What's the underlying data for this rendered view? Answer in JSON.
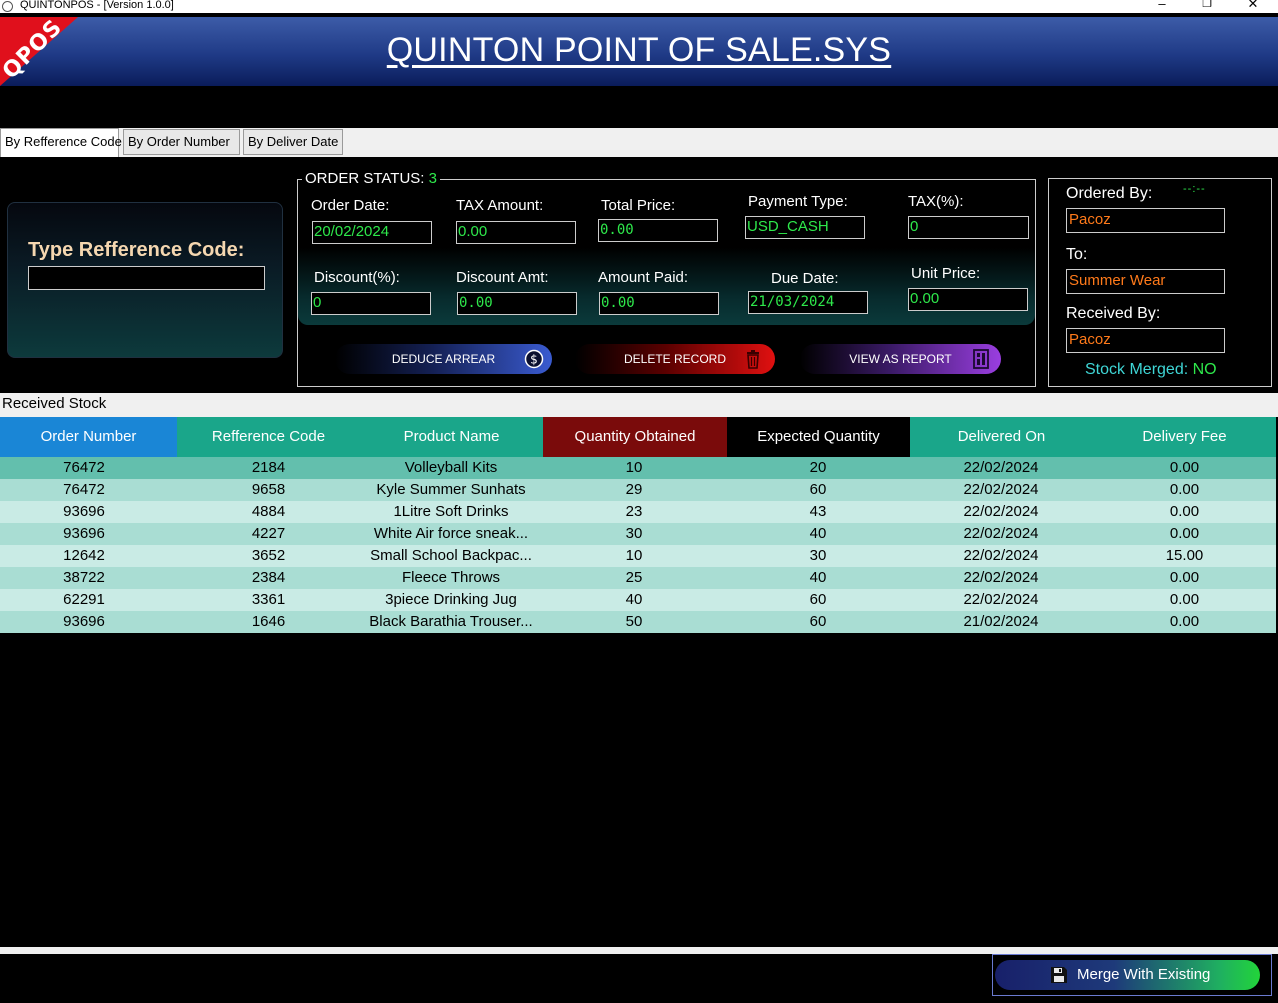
{
  "window": {
    "title": "QUINTONPOS - [Version 1.0.0]",
    "minimize": "–",
    "maximize": "❐",
    "close": "✕"
  },
  "header": {
    "title": "QUINTON POINT OF SALE.SYS",
    "logo_text": "QPOS"
  },
  "tabs": [
    {
      "label": "By Refference Code"
    },
    {
      "label": "By Order Number"
    },
    {
      "label": "By Deliver Date"
    }
  ],
  "search": {
    "label": "Type Refference Code:",
    "value": ""
  },
  "order_status": {
    "label": "ORDER STATUS:",
    "value": "3",
    "fields": {
      "order_date": {
        "label": "Order Date:",
        "value": "20/02/2024"
      },
      "tax_amount": {
        "label": "TAX Amount:",
        "value": "0.00"
      },
      "total_price": {
        "label": "Total Price:",
        "value": "0.00"
      },
      "payment_type": {
        "label": "Payment Type:",
        "value": "USD_CASH"
      },
      "tax_percent": {
        "label": "TAX(%):",
        "value": "0"
      },
      "discount_percent": {
        "label": "Discount(%):",
        "value": "0"
      },
      "discount_amt": {
        "label": "Discount Amt:",
        "value": "0.00"
      },
      "amount_paid": {
        "label": "Amount Paid:",
        "value": "0.00"
      },
      "due_date": {
        "label": "Due Date:",
        "value": "21/03/2024"
      },
      "unit_price": {
        "label": "Unit Price:",
        "value": "0.00"
      }
    }
  },
  "actions": {
    "deduce": "DEDUCE ARREAR",
    "delete": "DELETE RECORD",
    "report": "VIEW AS REPORT"
  },
  "receiver": {
    "ordered_by_label": "Ordered By:",
    "clock": "--:--",
    "ordered_by": "Pacoz",
    "to_label": "To:",
    "to": "Summer Wear",
    "received_by_label": "Received By:",
    "received_by": "Pacoz",
    "stock_merged_label": "Stock Merged:",
    "stock_merged": "NO"
  },
  "table": {
    "caption": "Received Stock",
    "columns": [
      "Order Number",
      "Refference Code",
      "Product Name",
      "Quantity Obtained",
      "Expected Quantity",
      "Delivered On",
      "Delivery Fee"
    ],
    "rows": [
      [
        "76472",
        "2184",
        "Volleyball Kits",
        "10",
        "20",
        "22/02/2024",
        "0.00"
      ],
      [
        "76472",
        "9658",
        "Kyle Summer Sunhats",
        "29",
        "60",
        "22/02/2024",
        "0.00"
      ],
      [
        "93696",
        "4884",
        "1Litre Soft Drinks",
        "23",
        "43",
        "22/02/2024",
        "0.00"
      ],
      [
        "93696",
        "4227",
        "White Air force sneak...",
        "30",
        "40",
        "22/02/2024",
        "0.00"
      ],
      [
        "12642",
        "3652",
        "Small School Backpac...",
        "10",
        "30",
        "22/02/2024",
        "15.00"
      ],
      [
        "38722",
        "2384",
        "Fleece Throws",
        "25",
        "40",
        "22/02/2024",
        "0.00"
      ],
      [
        "62291",
        "3361",
        "3piece Drinking Jug",
        "40",
        "60",
        "22/02/2024",
        "0.00"
      ],
      [
        "93696",
        "1646",
        "Black Barathia Trouser...",
        "50",
        "60",
        "21/02/2024",
        "0.00"
      ]
    ]
  },
  "merge_button": "Merge With Existing",
  "colors": {
    "accent_green": "#2ee84b",
    "header_blue": "#1f3a86",
    "col_order_number": "#1a86d6",
    "col_default": "#1aa68a",
    "col_quantity_obtained": "#7a0b0b",
    "col_expected_quantity": "#000000",
    "value_orange": "#ff7a1a"
  },
  "icons": {
    "deduce": "dollar-coin-icon",
    "delete": "trash-icon",
    "report": "report-icon",
    "merge": "floppy-disk-icon"
  }
}
